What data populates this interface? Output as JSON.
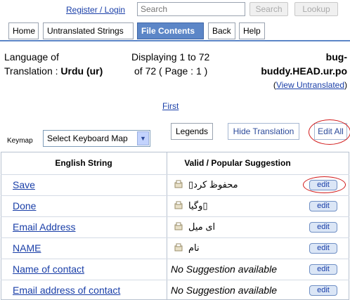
{
  "header": {
    "register_login": "Register / Login",
    "search_placeholder": "Search",
    "search_button": "Search",
    "lookup_button": "Lookup"
  },
  "tabs": [
    {
      "label": "Home"
    },
    {
      "label": "Untranslated Strings"
    },
    {
      "label": "File Contents",
      "active": true
    },
    {
      "label": "Back"
    },
    {
      "label": "Help"
    }
  ],
  "info": {
    "language_line1": "Language of",
    "language_line2_prefix": "Translation :",
    "language_value": "Urdu (ur)",
    "displaying_line1": "Displaying 1 to 72",
    "displaying_line2": "of 72 ( Page : 1 )",
    "file_line1": "bug-",
    "file_line2": "buddy.HEAD.ur.po",
    "view_untranslated": "View Untranslated",
    "paren_open": "(",
    "paren_close": ")"
  },
  "pager": {
    "first": "First"
  },
  "toolbar": {
    "keymap_label": "Keymap",
    "keyboard_select_value": "Select Keyboard Map",
    "legends": "Legends",
    "hide_translation": "Hide Translation",
    "edit_all": "Edit All"
  },
  "table": {
    "headers": {
      "english": "English String",
      "suggestion": "Valid / Popular Suggestion"
    },
    "rows": [
      {
        "english": "Save",
        "suggestion": "محفوظ کرد▯",
        "edit": "edit"
      },
      {
        "english": "Done",
        "suggestion": "▯وگیا",
        "edit": "edit"
      },
      {
        "english": "Email Address",
        "suggestion": "ای میل",
        "edit": "edit"
      },
      {
        "english": "NAME",
        "suggestion": "نام",
        "edit": "edit"
      },
      {
        "english": "Name of contact",
        "suggestion": "No Suggestion available",
        "edit": "edit"
      },
      {
        "english": "Email address of contact",
        "suggestion": "No Suggestion available",
        "edit": "edit"
      }
    ]
  },
  "colors": {
    "accent": "#5c86c7",
    "link": "#1a3fa8",
    "highlight": "#d21b1b"
  }
}
